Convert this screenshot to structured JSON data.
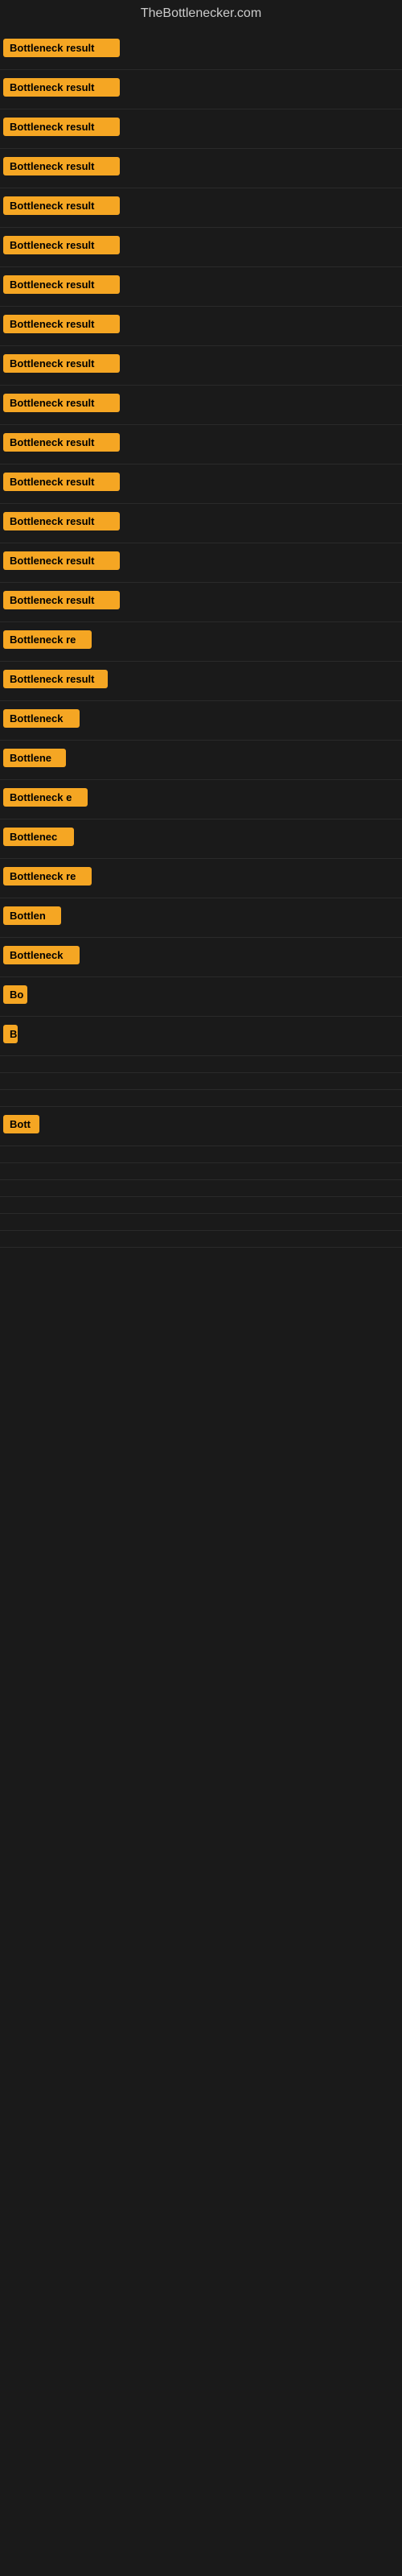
{
  "site": {
    "title": "TheBottlenecker.com"
  },
  "rows": [
    {
      "id": 1,
      "label": "Bottleneck result",
      "width": 145
    },
    {
      "id": 2,
      "label": "Bottleneck result",
      "width": 145
    },
    {
      "id": 3,
      "label": "Bottleneck result",
      "width": 145
    },
    {
      "id": 4,
      "label": "Bottleneck result",
      "width": 145
    },
    {
      "id": 5,
      "label": "Bottleneck result",
      "width": 145
    },
    {
      "id": 6,
      "label": "Bottleneck result",
      "width": 145
    },
    {
      "id": 7,
      "label": "Bottleneck result",
      "width": 145
    },
    {
      "id": 8,
      "label": "Bottleneck result",
      "width": 145
    },
    {
      "id": 9,
      "label": "Bottleneck result",
      "width": 145
    },
    {
      "id": 10,
      "label": "Bottleneck result",
      "width": 145
    },
    {
      "id": 11,
      "label": "Bottleneck result",
      "width": 145
    },
    {
      "id": 12,
      "label": "Bottleneck result",
      "width": 145
    },
    {
      "id": 13,
      "label": "Bottleneck result",
      "width": 145
    },
    {
      "id": 14,
      "label": "Bottleneck result",
      "width": 145
    },
    {
      "id": 15,
      "label": "Bottleneck result",
      "width": 145
    },
    {
      "id": 16,
      "label": "Bottleneck re",
      "width": 110
    },
    {
      "id": 17,
      "label": "Bottleneck result",
      "width": 130
    },
    {
      "id": 18,
      "label": "Bottleneck",
      "width": 95
    },
    {
      "id": 19,
      "label": "Bottlene",
      "width": 78
    },
    {
      "id": 20,
      "label": "Bottleneck e",
      "width": 105
    },
    {
      "id": 21,
      "label": "Bottlenec",
      "width": 88
    },
    {
      "id": 22,
      "label": "Bottleneck re",
      "width": 110
    },
    {
      "id": 23,
      "label": "Bottlen",
      "width": 72
    },
    {
      "id": 24,
      "label": "Bottleneck",
      "width": 95
    },
    {
      "id": 25,
      "label": "Bo",
      "width": 30
    },
    {
      "id": 26,
      "label": "B",
      "width": 18
    },
    {
      "id": 27,
      "label": "",
      "width": 0
    },
    {
      "id": 28,
      "label": "",
      "width": 0
    },
    {
      "id": 29,
      "label": "",
      "width": 8
    },
    {
      "id": 30,
      "label": "Bott",
      "width": 45
    },
    {
      "id": 31,
      "label": "",
      "width": 0
    },
    {
      "id": 32,
      "label": "",
      "width": 0
    },
    {
      "id": 33,
      "label": "",
      "width": 0
    },
    {
      "id": 34,
      "label": "",
      "width": 0
    },
    {
      "id": 35,
      "label": "",
      "width": 0
    },
    {
      "id": 36,
      "label": "",
      "width": 0
    }
  ]
}
